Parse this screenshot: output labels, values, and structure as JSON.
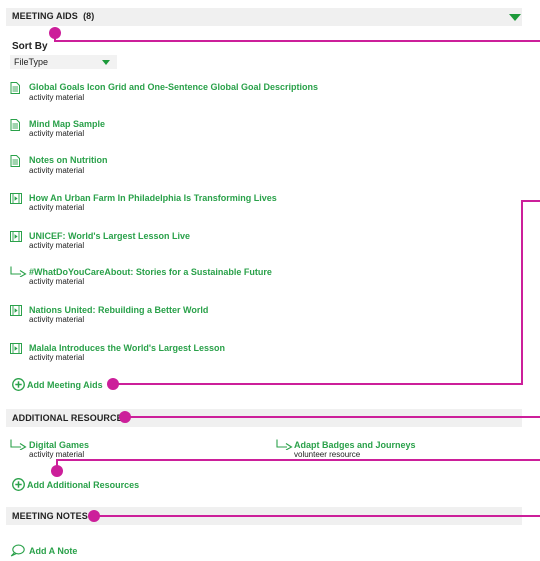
{
  "meeting_aids": {
    "title": "MEETING AIDS",
    "count": "(8)",
    "sort_by_label": "Sort By",
    "sort_value": "FileType",
    "items": [
      {
        "title": "Global Goals Icon Grid and One-Sentence Global Goal Descriptions",
        "subtitle": "activity material",
        "icon": "document-icon"
      },
      {
        "title": "Mind Map Sample",
        "subtitle": "activity material",
        "icon": "document-icon"
      },
      {
        "title": "Notes on Nutrition",
        "subtitle": "activity material",
        "icon": "document-icon"
      },
      {
        "title": "How An Urban Farm In Philadelphia Is Transforming Lives",
        "subtitle": "activity material",
        "icon": "video-icon"
      },
      {
        "title": "UNICEF: World's Largest Lesson Live",
        "subtitle": "activity material",
        "icon": "video-icon"
      },
      {
        "title": "#WhatDoYouCareAbout: Stories for a Sustainable Future",
        "subtitle": "activity material",
        "icon": "link-arrow-icon"
      },
      {
        "title": "Nations United: Rebuilding a Better World",
        "subtitle": "activity material",
        "icon": "video-icon"
      },
      {
        "title": "Malala Introduces the World's Largest Lesson",
        "subtitle": "activity material",
        "icon": "video-icon"
      }
    ],
    "add_label": "Add Meeting Aids"
  },
  "additional_resources": {
    "title": "ADDITIONAL RESOURCES",
    "items": [
      {
        "title": "Digital Games",
        "subtitle": "activity material",
        "icon": "link-arrow-icon"
      },
      {
        "title": "Adapt Badges and Journeys",
        "subtitle": "volunteer resource",
        "icon": "link-arrow-icon"
      }
    ],
    "add_label": "Add Additional Resources"
  },
  "meeting_notes": {
    "title": "MEETING NOTES",
    "add_label": "Add A Note"
  },
  "colors": {
    "accent_green": "#2aa14a",
    "annotation_magenta": "#cc1f9a",
    "section_bg": "#f0f0f0"
  }
}
